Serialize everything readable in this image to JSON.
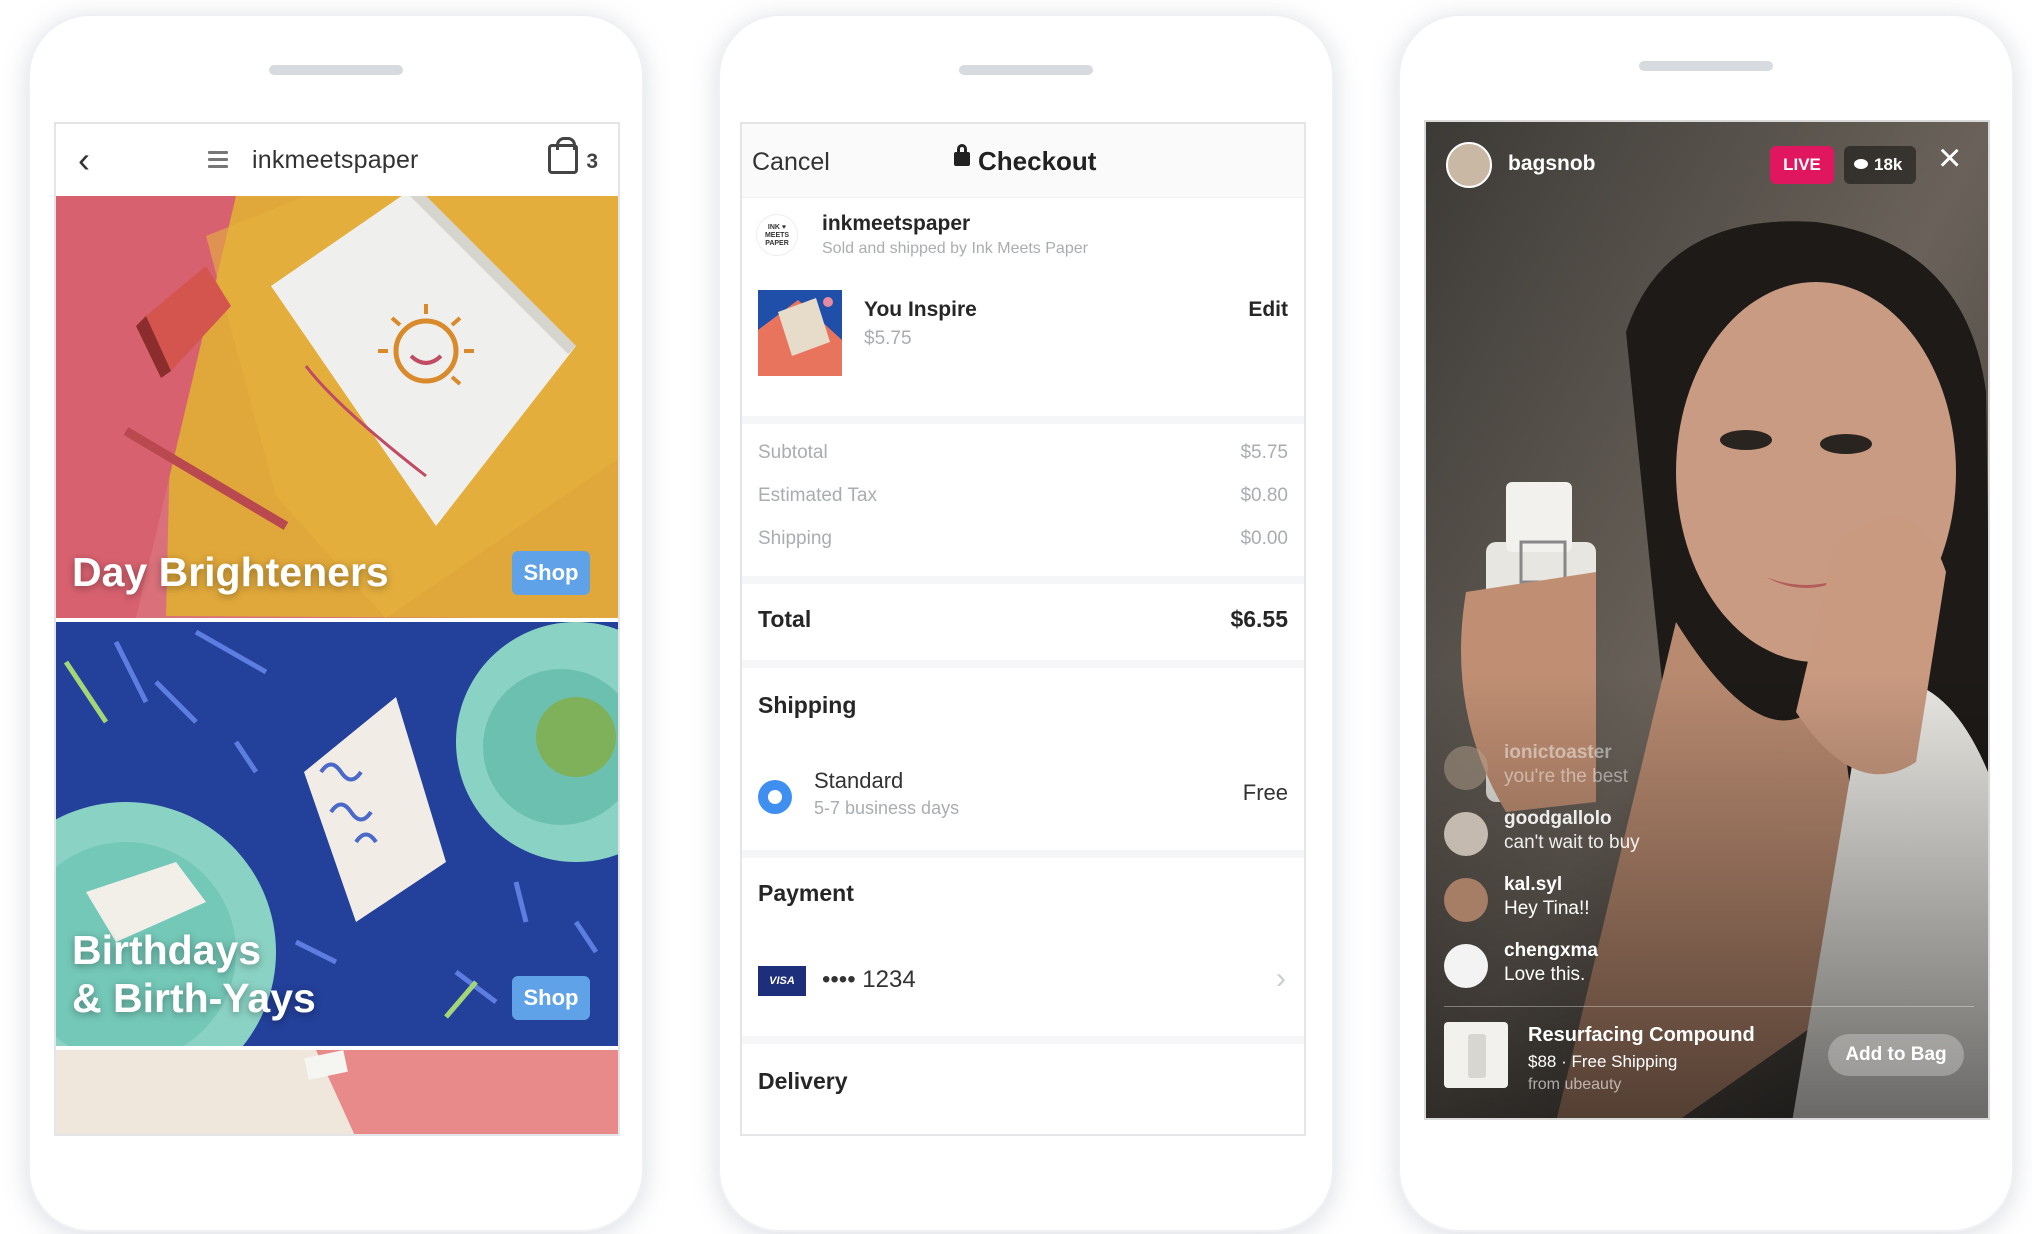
{
  "colors": {
    "accent_blue": "#3f8ff0",
    "shop_badge": "#5fa2e8",
    "live_badge": "#e0175f",
    "card_navy": "#1d2f7a"
  },
  "phone_shop": {
    "back_icon": "chevron-left-icon",
    "menu_icon": "hamburger-icon",
    "store_name": "inkmeetspaper",
    "bag_icon": "shopping-bag-icon",
    "bag_count": "3",
    "tiles": [
      {
        "label_line1": "Day Brighteners",
        "label_line2": "",
        "button": "Shop"
      },
      {
        "label_line1": "Birthdays",
        "label_line2": "& Birth-Yays",
        "button": "Shop"
      }
    ]
  },
  "phone_checkout": {
    "cancel": "Cancel",
    "lock_icon": "lock-icon",
    "title": "Checkout",
    "seller": {
      "logo_text": "INK ♥ MEETS PAPER",
      "name": "inkmeetspaper",
      "note": "Sold and shipped by Ink Meets Paper"
    },
    "item": {
      "name": "You Inspire",
      "price": "$5.75",
      "edit": "Edit"
    },
    "summary": [
      {
        "label": "Subtotal",
        "value": "$5.75"
      },
      {
        "label": "Estimated Tax",
        "value": "$0.80"
      },
      {
        "label": "Shipping",
        "value": "$0.00"
      }
    ],
    "total": {
      "label": "Total",
      "value": "$6.55"
    },
    "shipping": {
      "heading": "Shipping",
      "option": "Standard",
      "sub": "5-7 business days",
      "price": "Free"
    },
    "payment": {
      "heading": "Payment",
      "card_brand": "VISA",
      "card_number": "•••• 1234",
      "chevron_icon": "chevron-right-icon"
    },
    "delivery": {
      "heading": "Delivery"
    }
  },
  "phone_live": {
    "username": "bagsnob",
    "live": "LIVE",
    "viewer_icon": "eye-icon",
    "viewers": "18k",
    "close_icon": "close-icon",
    "comments": [
      {
        "user": "ionictoaster",
        "text": "you're the best"
      },
      {
        "user": "goodgallolo",
        "text": "can't wait to buy"
      },
      {
        "user": "kal.syl",
        "text": "Hey Tina!!"
      },
      {
        "user": "chengxma",
        "text": "Love this."
      }
    ],
    "product": {
      "name": "Resurfacing Compound",
      "price": "$88 · Free Shipping",
      "from": "from ubeauty",
      "button": "Add to Bag"
    }
  }
}
